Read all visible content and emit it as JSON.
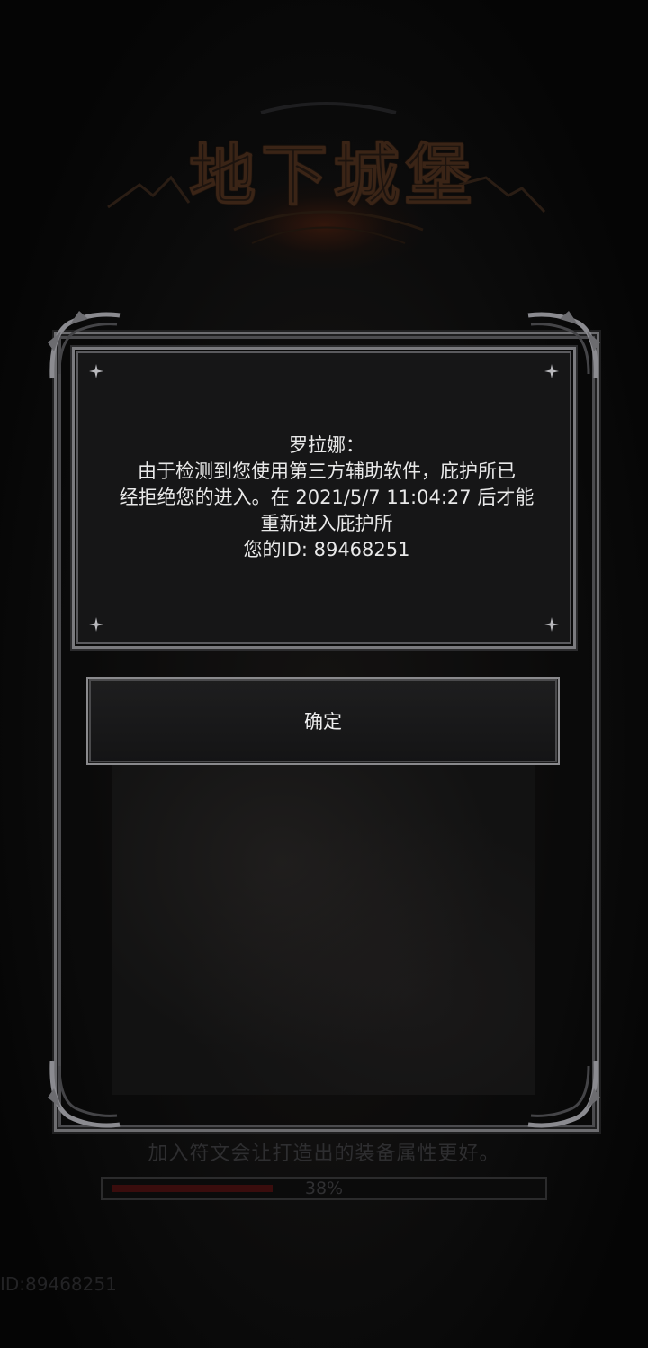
{
  "game": {
    "logo_title": "地下城堡"
  },
  "dialog": {
    "lines": [
      "罗拉娜：",
      "由于检测到您使用第三方辅助软件，庇护所已",
      "经拒绝您的进入。在 2021/5/7 11:04:27 后才能",
      "重新进入庇护所",
      "您的ID: 89468251"
    ],
    "confirm_label": "确定"
  },
  "loading": {
    "tip": "加入符文会让打造出的装备属性更好。",
    "progress_percent": 38,
    "progress_label": "38%"
  },
  "footer": {
    "player_id": "ID:89468251"
  },
  "colors": {
    "background": "#050505",
    "frame": "#7a7a7e",
    "text": "#e9e9e9",
    "progress_fill": "#3a0d0d"
  },
  "icons": {
    "corner_sparkle": "four-point-star-icon",
    "frame_corner": "ornate-corner-icon"
  }
}
